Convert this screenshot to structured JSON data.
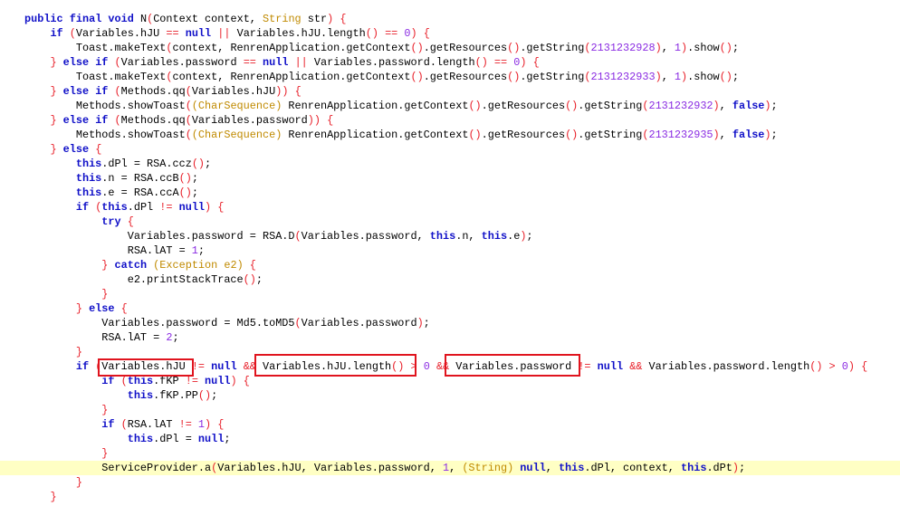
{
  "editor": {
    "highlighted_line": 32,
    "colors": {
      "keyword": "#1010c8",
      "punctuation": "#e8202a",
      "type": "#c08a00",
      "number": "#8a2be2",
      "highlight": "#ffffc4",
      "annotation_box": "#e0141e"
    },
    "code_lines": [
      {
        "text": "public final void N(Context context, String str) {"
      },
      {
        "text": "    if (Variables.hJU == null || Variables.hJU.length() == 0) {"
      },
      {
        "text": "        Toast.makeText(context, RenrenApplication.getContext().getResources().getString(2131232928), 1).show();"
      },
      {
        "text": "    } else if (Variables.password == null || Variables.password.length() == 0) {"
      },
      {
        "text": "        Toast.makeText(context, RenrenApplication.getContext().getResources().getString(2131232933), 1).show();"
      },
      {
        "text": "    } else if (Methods.qq(Variables.hJU)) {"
      },
      {
        "text": "        Methods.showToast((CharSequence) RenrenApplication.getContext().getResources().getString(2131232932), false);"
      },
      {
        "text": "    } else if (Methods.qq(Variables.password)) {"
      },
      {
        "text": "        Methods.showToast((CharSequence) RenrenApplication.getContext().getResources().getString(2131232935), false);"
      },
      {
        "text": "    } else {"
      },
      {
        "text": "        this.dPl = RSA.ccz();"
      },
      {
        "text": "        this.n = RSA.ccB();"
      },
      {
        "text": "        this.e = RSA.ccA();"
      },
      {
        "text": "        if (this.dPl != null) {"
      },
      {
        "text": "            try {"
      },
      {
        "text": "                Variables.password = RSA.D(Variables.password, this.n, this.e);"
      },
      {
        "text": "                RSA.lAT = 1;"
      },
      {
        "text": "            } catch (Exception e2) {"
      },
      {
        "text": "                e2.printStackTrace();"
      },
      {
        "text": "            }"
      },
      {
        "text": "        } else {"
      },
      {
        "text": "            Variables.password = Md5.toMD5(Variables.password);"
      },
      {
        "text": "            RSA.lAT = 2;"
      },
      {
        "text": "        }"
      },
      {
        "text": "        if (Variables.hJU != null && Variables.hJU.length() > 0 && Variables.password != null && Variables.password.length() > 0) {"
      },
      {
        "text": "            if (this.fKP != null) {"
      },
      {
        "text": "                this.fKP.PP();"
      },
      {
        "text": "            }"
      },
      {
        "text": "            if (RSA.lAT != 1) {"
      },
      {
        "text": "                this.dPl = null;"
      },
      {
        "text": "            }"
      },
      {
        "text": "            ServiceProvider.a(Variables.hJU, Variables.password, 1, (String) null, this.dPl, context, this.dPt);"
      },
      {
        "text": "        }"
      },
      {
        "text": "    }"
      }
    ]
  }
}
